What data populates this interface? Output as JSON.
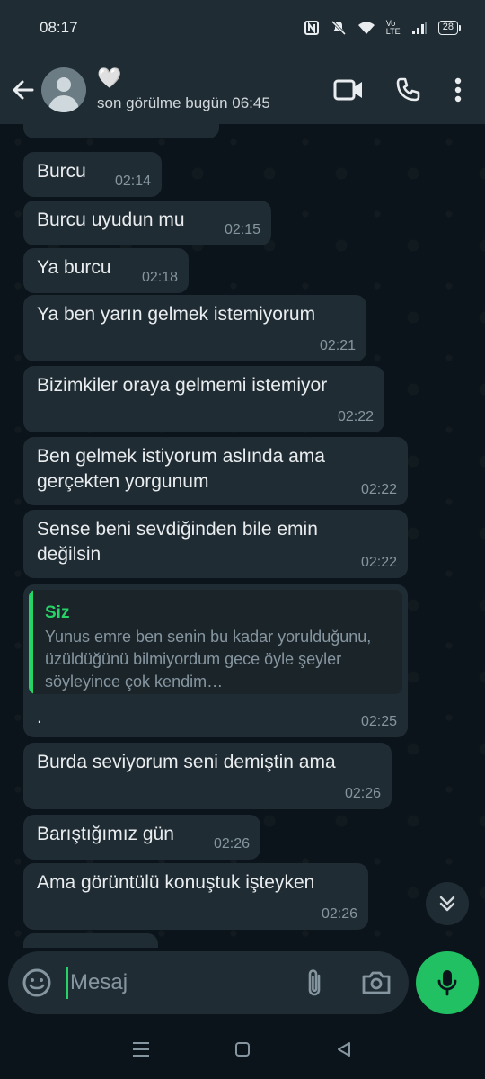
{
  "status_bar": {
    "time": "08:17",
    "battery": "28",
    "network": "Vo LTE"
  },
  "contact": {
    "name": "🤍",
    "status": "son görülme bugün 06:45"
  },
  "messages": [
    {
      "text": "Burcu",
      "time": "02:14"
    },
    {
      "text": "Burcu uyudun mu",
      "time": "02:15"
    },
    {
      "text": "Ya burcu",
      "time": "02:18"
    },
    {
      "text": "Ya ben yarın gelmek istemiyorum",
      "time": "02:21"
    },
    {
      "text": "Bizimkiler oraya gelmemi istemiyor",
      "time": "02:22"
    },
    {
      "text": "Ben gelmek istiyorum aslında ama gerçekten yorgunum",
      "time": "02:22"
    },
    {
      "text": "Sense beni sevdiğinden bile emin değilsin",
      "time": "02:22"
    },
    {
      "text": ".",
      "time": "02:25",
      "quote": {
        "author": "Siz",
        "text": "Yunus emre ben senin bu kadar yorulduğunu, üzüldüğünü bilmiyordum gece öyle şeyler söyleyince çok  kendim…"
      }
    },
    {
      "text": "Burda seviyorum seni demiştin ama",
      "time": "02:26"
    },
    {
      "text": "Barıştığımız gün",
      "time": "02:26"
    },
    {
      "text": "Ama görüntülü konuştuk işteyken",
      "time": "02:26"
    }
  ],
  "composer": {
    "placeholder": "Mesaj"
  },
  "colors": {
    "accent": "#25d366",
    "bubble": "#202c33",
    "header": "#1f2c33",
    "background": "#0b141a"
  },
  "icons": [
    "back-arrow-icon",
    "video-call-icon",
    "phone-icon",
    "more-icon",
    "emoji-icon",
    "attach-icon",
    "camera-icon",
    "mic-icon",
    "scroll-down-icon"
  ]
}
